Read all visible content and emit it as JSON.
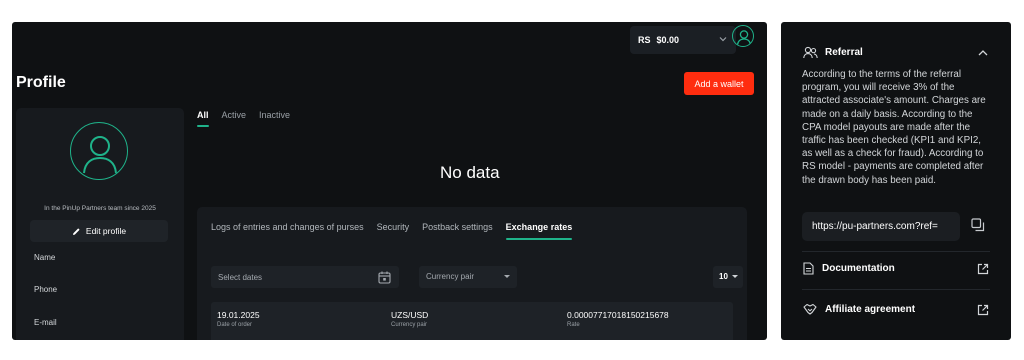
{
  "header": {
    "currency_code": "RS",
    "balance": "$0.00"
  },
  "profile": {
    "title": "Profile",
    "add_wallet_label": "Add a wallet",
    "team_since": "In the PinUp Partners team since 2025",
    "edit_profile_label": "Edit profile",
    "fields": [
      "Name",
      "Phone",
      "E-mail"
    ]
  },
  "wallet_tabs": [
    "All",
    "Active",
    "Inactive"
  ],
  "no_data_text": "No data",
  "logs": {
    "tabs": [
      "Logs of entries and changes of purses",
      "Security",
      "Postback settings",
      "Exchange rates"
    ],
    "date_placeholder": "Select dates",
    "currency_pair_placeholder": "Currency pair",
    "per_page": "10",
    "row": {
      "date": "19.01.2025",
      "date_label": "Date of order",
      "pair": "UZS/USD",
      "pair_label": "Currency pair",
      "rate": "0.00007717018150215678",
      "rate_label": "Rate"
    }
  },
  "sidebar": {
    "referral_title": "Referral",
    "referral_text": "According to the terms of the referral program, you will receive 3% of the attracted associate's amount. Charges are made on a daily basis. According to the CPA model payouts are made after the traffic has been checked (KPI1 and KPI2, as well as a check for fraud). According to RS model - payments are completed after the drawn body has been paid.",
    "referral_link": "https://pu-partners.com?ref=",
    "documentation_label": "Documentation",
    "affiliate_agreement_label": "Affiliate agreement"
  },
  "colors": {
    "accent": "#1fb38a",
    "button_red": "#ff2d0f",
    "panel_bg": "#0f1113",
    "card_bg": "#171a1e"
  }
}
